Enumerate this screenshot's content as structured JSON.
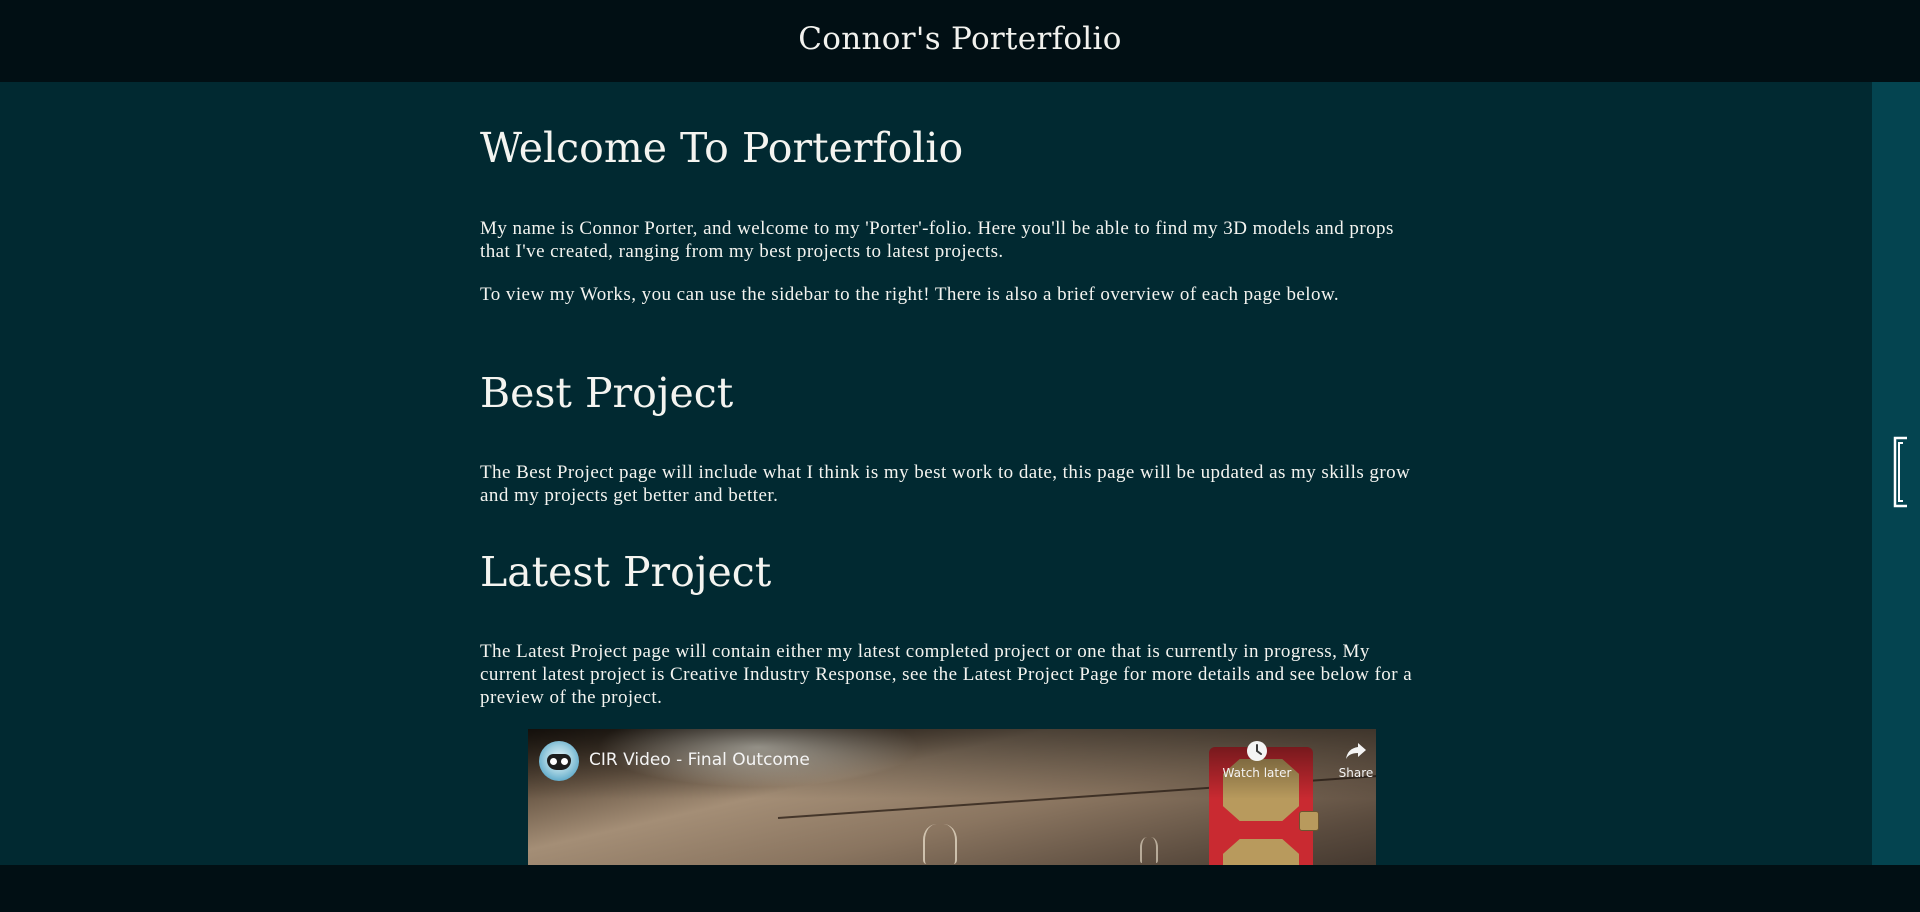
{
  "header": {
    "title": "Connor's Porterfolio"
  },
  "main": {
    "sections": [
      {
        "heading": "Welcome To Porterfolio",
        "paragraphs": [
          "My name is Connor Porter, and welcome to my 'Porter'-folio. Here you'll be able to find my 3D models and props that I've created, ranging from my best projects to latest projects.",
          "To view my Works, you can use the sidebar to the right! There is also a brief overview of each page below."
        ]
      },
      {
        "heading": "Best Project",
        "paragraphs": [
          "The Best Project page will include what I think is my best work to date, this page will be updated as my skills grow and my projects get better and better."
        ]
      },
      {
        "heading": "Latest Project",
        "paragraphs": [
          "The Latest Project page will contain either my latest completed project or one that is currently in progress, My current latest project is Creative Industry Response, see the Latest Project Page for more details and see below for a preview of the project."
        ]
      }
    ]
  },
  "video": {
    "title": "CIR Video - Final Outcome",
    "watch_later_label": "Watch later",
    "share_label": "Share",
    "icons": {
      "avatar": "channel-avatar-icon",
      "watch_later": "clock-icon",
      "share": "share-arrow-icon"
    }
  },
  "sidebar": {
    "toggle_icon": "bracket-toggle-icon"
  },
  "colors": {
    "header_bg": "#010f14",
    "main_bg": "#012931",
    "sidebar_bg": "#044450",
    "text": "#f4f4f0"
  }
}
